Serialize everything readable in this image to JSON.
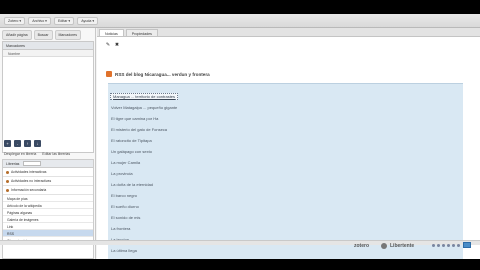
{
  "menubar": {
    "items": [
      "Zotero ▾",
      "Archivo ▾",
      "Editar ▾",
      "Ayuda ▾"
    ]
  },
  "left": {
    "top_tabs": [
      "Añadir página",
      "Buscar",
      "Marcadores"
    ],
    "panel_header": "Marcadores",
    "panel_column": "Nombre",
    "toolbar_icons": [
      "+",
      "-",
      "↑",
      "↓"
    ],
    "mid_tabs": [
      "Desplegar en libreria",
      "Editar las librerias"
    ],
    "list_header": "Librerias",
    "extension_items": [
      "Actividades interactivas",
      "Actividades no interactivas",
      "Información secundaria"
    ],
    "plain_items": [
      "Mapa de pías",
      "Artículo de la wikipedia",
      "Páginas algunas",
      "Galería de imágenes",
      "Link",
      "RSS",
      "Otra más vistos"
    ],
    "selected_item": "RSS"
  },
  "main": {
    "tabs": [
      "Noticias",
      "Propiedades"
    ],
    "active_tab": "Noticias",
    "edit_icons": [
      "✎",
      "✖"
    ],
    "feed_title": "RSS del blog Nicaragua... verdun y frontera",
    "feed_entries": [
      "Managua ... territorio de contrastes",
      "Volver Matagalpa ... pequeño gigante",
      "El tigre que camina por Ha",
      "El misterio del gato de Fonseca",
      "El ratoncito de Tipitapa",
      "Un galápago con sexto",
      "La mujer Camila",
      "La provincia",
      "La doña de la eternidad",
      "El barco negro",
      "El sueño diurno",
      "El sonido de mis",
      "La frontera",
      "La leccion",
      "La última llega"
    ]
  },
  "status": {
    "brand_left": "zotero",
    "brand_right": "Libertente"
  },
  "colors": {
    "feed_background": "#d9e8f3",
    "rss_orange": "#e0722b",
    "selection_blue": "#c7d9ee"
  }
}
